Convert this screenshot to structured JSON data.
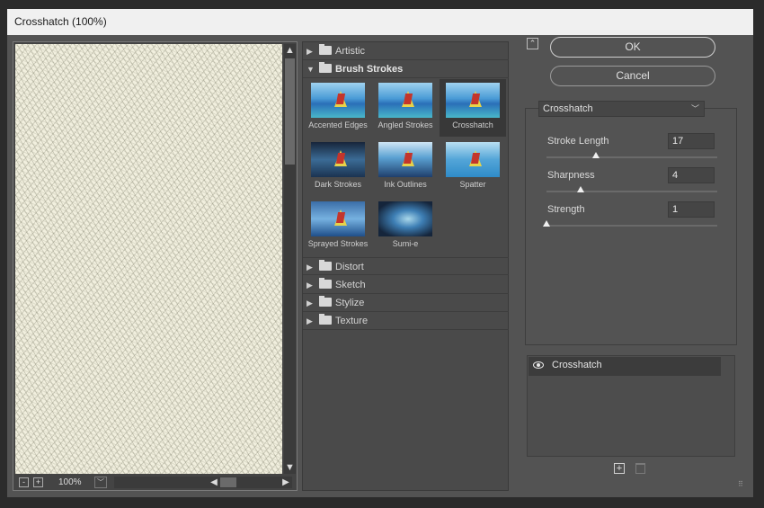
{
  "window": {
    "title": "Crosshatch (100%)"
  },
  "preview": {
    "zoom_value": "100%",
    "zoom_out": "-",
    "zoom_in": "+"
  },
  "gallery": {
    "categories": [
      {
        "label": "Artistic",
        "expanded": false
      },
      {
        "label": "Brush Strokes",
        "expanded": true
      },
      {
        "label": "Distort",
        "expanded": false
      },
      {
        "label": "Sketch",
        "expanded": false
      },
      {
        "label": "Stylize",
        "expanded": false
      },
      {
        "label": "Texture",
        "expanded": false
      }
    ],
    "brush_strokes": [
      {
        "label": "Accented Edges",
        "selected": false
      },
      {
        "label": "Angled Strokes",
        "selected": false
      },
      {
        "label": "Crosshatch",
        "selected": true
      },
      {
        "label": "Dark Strokes",
        "selected": false
      },
      {
        "label": "Ink Outlines",
        "selected": false
      },
      {
        "label": "Spatter",
        "selected": false
      },
      {
        "label": "Sprayed Strokes",
        "selected": false
      },
      {
        "label": "Sumi-e",
        "selected": false
      }
    ]
  },
  "actions": {
    "ok": "OK",
    "cancel": "Cancel"
  },
  "filter_select": {
    "value": "Crosshatch"
  },
  "params": [
    {
      "label": "Stroke Length",
      "value": "17",
      "level": 0.29
    },
    {
      "label": "Sharpness",
      "value": "4",
      "level": 0.2
    },
    {
      "label": "Strength",
      "value": "1",
      "level": 0.0
    }
  ],
  "layers": {
    "items": [
      {
        "name": "Crosshatch",
        "visible": true
      }
    ]
  },
  "icons": {
    "collapse": "collapse-icon",
    "eye": "eye-icon",
    "new_layer": "new-effect-layer-icon",
    "delete": "trash-icon",
    "folder": "folder-icon"
  }
}
